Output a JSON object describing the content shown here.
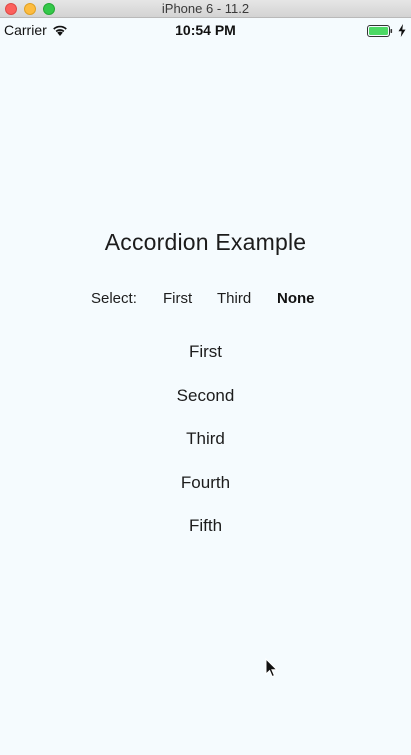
{
  "window": {
    "title": "iPhone 6 - 11.2"
  },
  "status_bar": {
    "carrier": "Carrier",
    "time": "10:54 PM",
    "battery_color": "#4cd964"
  },
  "page": {
    "title": "Accordion Example",
    "background": "#f5fbfe"
  },
  "selector": {
    "label": "Select:",
    "options": [
      {
        "label": "First",
        "selected": false
      },
      {
        "label": "Third",
        "selected": false
      },
      {
        "label": "None",
        "selected": true
      }
    ]
  },
  "accordion": {
    "items": [
      {
        "label": "First"
      },
      {
        "label": "Second"
      },
      {
        "label": "Third"
      },
      {
        "label": "Fourth"
      },
      {
        "label": "Fifth"
      }
    ]
  }
}
